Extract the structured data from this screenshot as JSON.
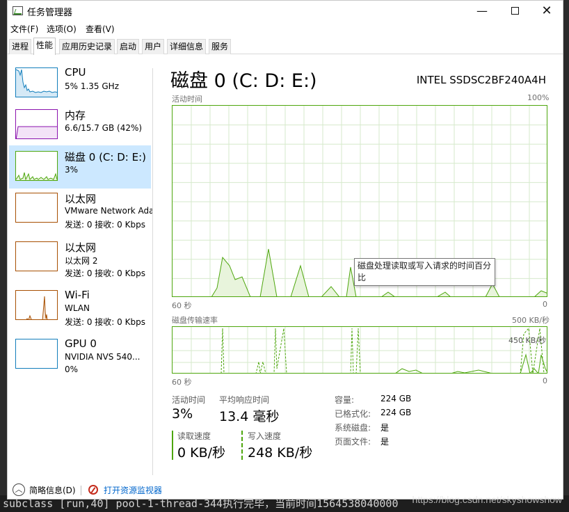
{
  "app_title": "任务管理器",
  "window_controls": {
    "minimize": "—",
    "close": "✕"
  },
  "menu": [
    "文件(F)",
    "选项(O)",
    "查看(V)"
  ],
  "tabs": [
    "进程",
    "性能",
    "应用历史记录",
    "启动",
    "用户",
    "详细信息",
    "服务"
  ],
  "active_tab": "性能",
  "perf_items": [
    {
      "name": "CPU",
      "line1": "5%  1.35 GHz",
      "line2": "",
      "color": "#117dbb"
    },
    {
      "name": "内存",
      "line1": "6.6/15.7 GB (42%)",
      "line2": "",
      "color": "#8b12ae"
    },
    {
      "name": "磁盘 0 (C: D: E:)",
      "line1": "3%",
      "line2": "",
      "color": "#4da60c"
    },
    {
      "name": "以太网",
      "line1": "VMware Network Adapt",
      "line2": "发送: 0  接收: 0 Kbps",
      "color": "#a74f01"
    },
    {
      "name": "以太网",
      "line1": "以太网 2",
      "line2": "发送: 0  接收: 0 Kbps",
      "color": "#a74f01"
    },
    {
      "name": "Wi-Fi",
      "line1": "WLAN",
      "line2": "发送: 0  接收: 0 Kbps",
      "color": "#a74f01"
    },
    {
      "name": "GPU 0",
      "line1": "NVIDIA NVS 540...",
      "line2": "0%",
      "color": "#117dbb"
    }
  ],
  "disk": {
    "title": "磁盘 0 (C: D: E:)",
    "model": "INTEL SSDSC2BF240A4H",
    "activity_graph": {
      "label": "活动时间",
      "max_label": "100%",
      "time_label": "60 秒",
      "min_label": "0"
    },
    "transfer_graph": {
      "label": "磁盘传输速率",
      "max_label": "500 KB/秒",
      "inner_label": "450 KB/秒",
      "time_label": "60 秒",
      "min_label": "0"
    },
    "tooltip": "磁盘处理读取或写入请求的时间百分比",
    "stats": {
      "active_time_label": "活动时间",
      "active_time": "3%",
      "avg_response_label": "平均响应时间",
      "avg_response": "13.4 毫秒",
      "read_speed_label": "读取速度",
      "read_speed": "0 KB/秒",
      "write_speed_label": "写入速度",
      "write_speed": "248 KB/秒"
    },
    "info": [
      {
        "label": "容量:",
        "value": "224 GB"
      },
      {
        "label": "已格式化:",
        "value": "224 GB"
      },
      {
        "label": "系统磁盘:",
        "value": "是"
      },
      {
        "label": "页面文件:",
        "value": "是"
      }
    ]
  },
  "footer": {
    "fewer_details": "简略信息(D)",
    "open_monitor": "打开资源监视器"
  },
  "background": {
    "terminal_line": "subclass   [run,40]    pool-1-thread-344执行完毕，当前时间1564538040000",
    "watermark": "https://blog.csdn.net/skyshowshow"
  }
}
